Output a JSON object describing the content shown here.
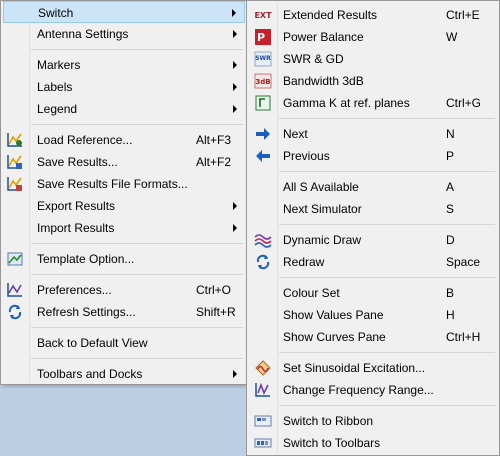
{
  "main_menu": {
    "items": [
      {
        "label": "Switch",
        "shortcut": "",
        "submenu": true,
        "highlighted": true
      },
      {
        "label": "Antenna Settings",
        "shortcut": "",
        "submenu": true
      },
      {
        "label": "Markers",
        "shortcut": "",
        "submenu": true
      },
      {
        "label": "Labels",
        "shortcut": "",
        "submenu": true
      },
      {
        "label": "Legend",
        "shortcut": "",
        "submenu": true
      },
      {
        "label": "Load Reference...",
        "shortcut": "Alt+F3",
        "icon": "load-reference-icon"
      },
      {
        "label": "Save Results...",
        "shortcut": "Alt+F2",
        "icon": "save-results-icon"
      },
      {
        "label": "Save Results File Formats...",
        "shortcut": "",
        "icon": "save-formats-icon"
      },
      {
        "label": "Export Results",
        "shortcut": "",
        "submenu": true
      },
      {
        "label": "Import Results",
        "shortcut": "",
        "submenu": true
      },
      {
        "label": "Template Option...",
        "shortcut": "",
        "icon": "template-icon"
      },
      {
        "label": "Preferences...",
        "shortcut": "Ctrl+O",
        "icon": "preferences-icon"
      },
      {
        "label": "Refresh Settings...",
        "shortcut": "Shift+R",
        "icon": "refresh-icon"
      },
      {
        "label": "Back to Default View",
        "shortcut": ""
      },
      {
        "label": "Toolbars and Docks",
        "shortcut": "",
        "submenu": true
      }
    ]
  },
  "sub_menu": {
    "items": [
      {
        "label": "Extended Results",
        "shortcut": "Ctrl+E",
        "icon": "ext-icon",
        "icon_text": "EXT"
      },
      {
        "label": "Power Balance",
        "shortcut": "W",
        "icon": "power-balance-icon",
        "icon_text": "P"
      },
      {
        "label": "SWR & GD",
        "shortcut": "",
        "icon": "swr-gd-icon",
        "icon_text": "SWR"
      },
      {
        "label": "Bandwidth 3dB",
        "shortcut": "",
        "icon": "bandwidth-icon",
        "icon_text": "3dB"
      },
      {
        "label": "Gamma K at ref. planes",
        "shortcut": "Ctrl+G",
        "icon": "gamma-icon"
      },
      {
        "label": "Next",
        "shortcut": "N",
        "icon": "arrow-right-icon"
      },
      {
        "label": "Previous",
        "shortcut": "P",
        "icon": "arrow-left-icon"
      },
      {
        "label": "All S Available",
        "shortcut": "A"
      },
      {
        "label": "Next Simulator",
        "shortcut": "S"
      },
      {
        "label": "Dynamic Draw",
        "shortcut": "D",
        "icon": "dynamic-draw-icon"
      },
      {
        "label": "Redraw",
        "shortcut": "Space",
        "icon": "redraw-icon"
      },
      {
        "label": "Colour Set",
        "shortcut": "B"
      },
      {
        "label": "Show Values Pane",
        "shortcut": "H"
      },
      {
        "label": "Show Curves Pane",
        "shortcut": "Ctrl+H"
      },
      {
        "label": "Set Sinusoidal Excitation...",
        "shortcut": "",
        "icon": "sinusoidal-icon"
      },
      {
        "label": "Change Frequency Range...",
        "shortcut": "",
        "icon": "frequency-range-icon"
      },
      {
        "label": "Switch to Ribbon",
        "shortcut": "",
        "icon": "ribbon-icon"
      },
      {
        "label": "Switch to Toolbars",
        "shortcut": "",
        "icon": "toolbars-icon"
      }
    ]
  }
}
